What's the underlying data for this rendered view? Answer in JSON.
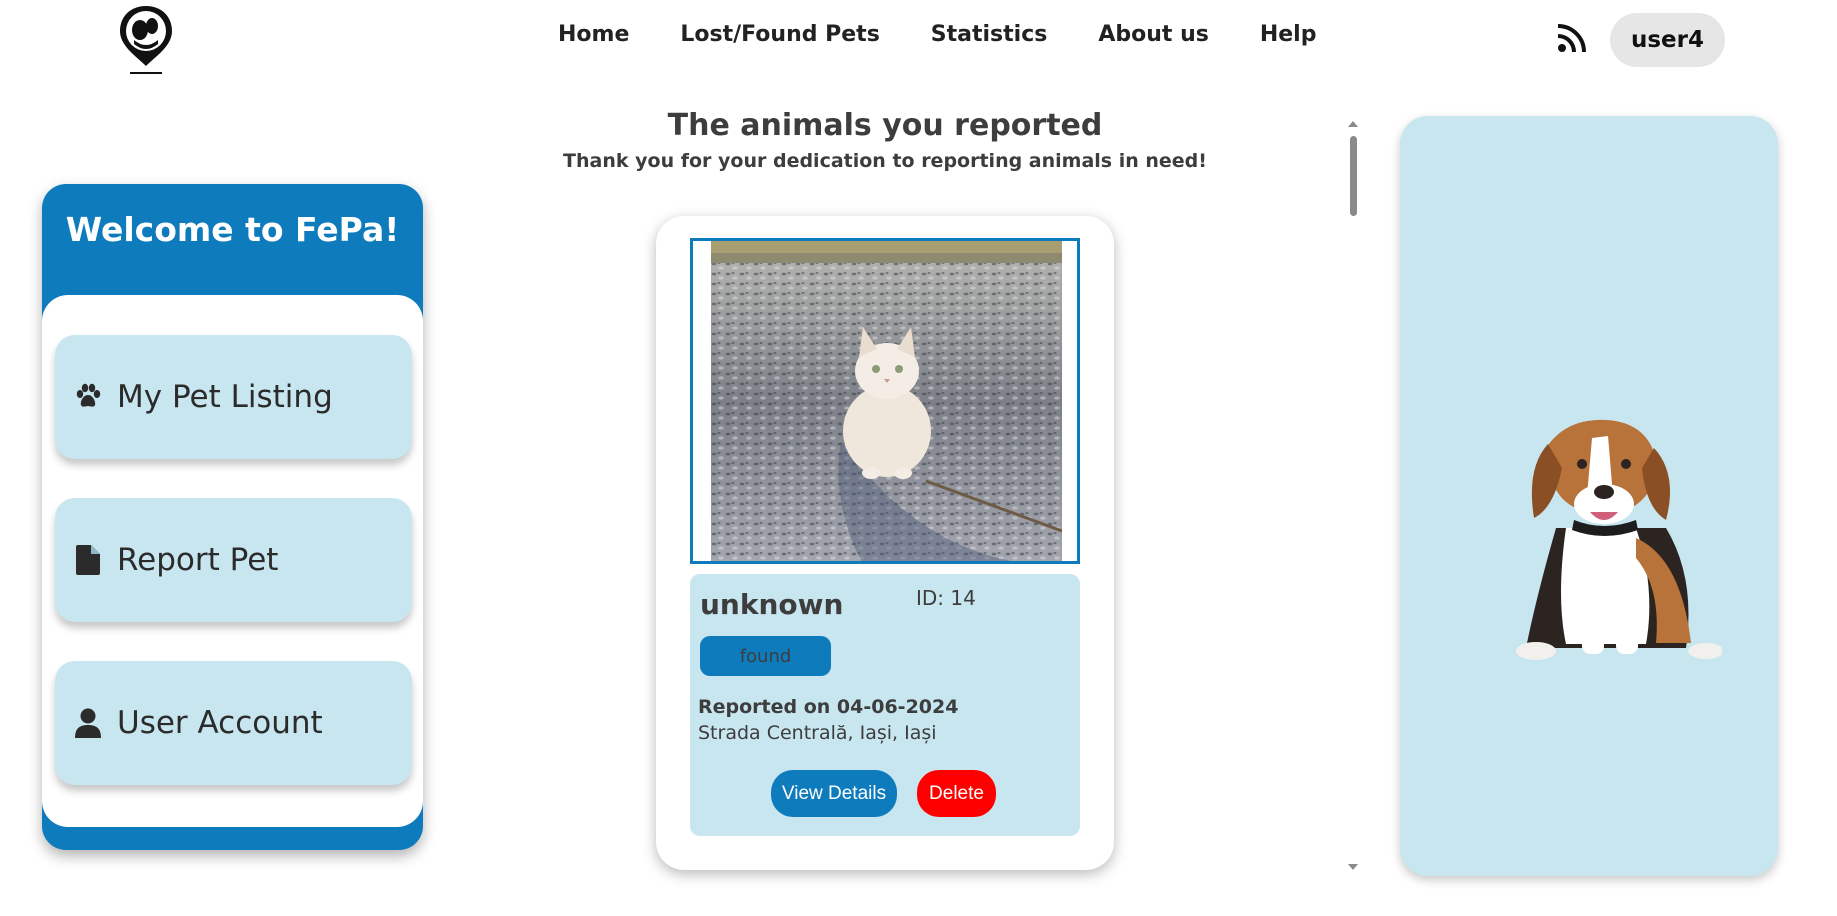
{
  "nav": {
    "items": [
      "Home",
      "Lost/Found Pets",
      "Statistics",
      "About us",
      "Help"
    ],
    "user_label": "user4"
  },
  "sidebar": {
    "title": "Welcome to FePa!",
    "items": [
      {
        "label": "My Pet Listing",
        "icon": "paw-icon"
      },
      {
        "label": "Report Pet",
        "icon": "file-icon"
      },
      {
        "label": "User Account",
        "icon": "user-icon"
      }
    ]
  },
  "main": {
    "title": "The animals you reported",
    "subtitle": "Thank you for your dedication to reporting animals in need!"
  },
  "card": {
    "name": "unknown",
    "id": "ID: 14",
    "status": "found",
    "reported": "Reported on 04-06-2024",
    "location": "Strada Centrală, Iași, Iași",
    "view_label": "View Details",
    "delete_label": "Delete"
  },
  "colors": {
    "accent": "#0e7bbd",
    "panel": "#c8e6f0",
    "danger": "#ff0000"
  }
}
